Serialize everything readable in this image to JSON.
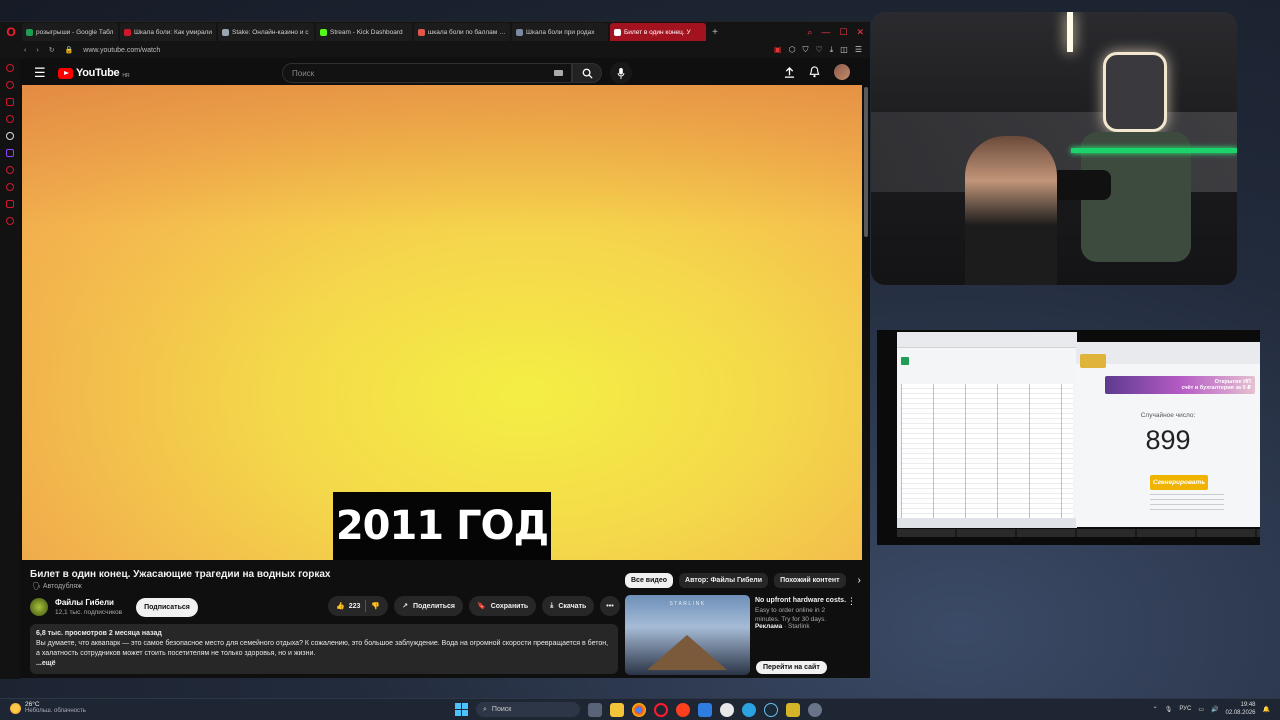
{
  "browser": {
    "tabs": [
      {
        "label": "розыгрыши - Google Табл",
        "color": "#1f9d55",
        "active": false
      },
      {
        "label": "Шкала боли: Как умирали",
        "color": "#d2162b",
        "active": false
      },
      {
        "label": "Stake: Онлайн-казино и с",
        "color": "#9aa4b2",
        "active": false
      },
      {
        "label": "Stream - Kick Dashboard",
        "color": "#53fc18",
        "active": false
      },
      {
        "label": "шкала боли по баллам ро",
        "color": "#e2574c",
        "active": false
      },
      {
        "label": "Шкала боли при родах",
        "color": "#7a8aa0",
        "active": false
      },
      {
        "label": "Билет в один конец. У",
        "color": "#ffffff",
        "active": true
      }
    ],
    "new_tab": "+",
    "url": "www.youtube.com/watch"
  },
  "youtube": {
    "logo_text": "YouTube",
    "region": "HR",
    "search_placeholder": "Поиск",
    "caption": "2011 ГОД",
    "title": "Билет в один конец. Ужасающие трагедии на водных горках",
    "autodub": "Автодубляж",
    "channel": {
      "name": "Файлы Гибели",
      "subs": "12,1 тыс. подписчиков"
    },
    "subscribe": "Подписаться",
    "likes": "223",
    "share": "Поделиться",
    "save": "Сохранить",
    "download": "Скачать",
    "description": {
      "meta": "6,8 тыс. просмотров  2 месяца назад",
      "text": "Вы думаете, что аквапарк — это самое безопасное место для семейного отдыха? К сожалению, это большое заблуждение. Вода на огромной скорости превращается в бетон, а халатность сотрудников может стоить посетителям не только здоровья, но и жизни.",
      "more": "...ещё"
    },
    "chips": [
      "Все видео",
      "Автор: Файлы Гибели",
      "Похожий контент"
    ],
    "ad": {
      "brand": "STARLINK",
      "title": "No upfront hardware costs.",
      "body": "Easy to order online in 2 minutes. Try for 30 days.",
      "label": "Реклама",
      "advertiser": "Starlink",
      "cta": "Перейти на сайт"
    }
  },
  "inset": {
    "banner": "Открытие ИП\nсчёт и бухгалтерия за 0 ₽",
    "random_label": "Случайное число:",
    "random_number": "899",
    "generate": "Сгенерировать"
  },
  "taskbar": {
    "temp": "26°C",
    "weather": "Небольш. облачность",
    "search": "Поиск",
    "lang": "РУС",
    "time": "19:48",
    "date": "02.08.2026"
  },
  "colors": {
    "accent": "#ff0000",
    "opera": "#ff1b2d",
    "kick": "#53fc18"
  }
}
